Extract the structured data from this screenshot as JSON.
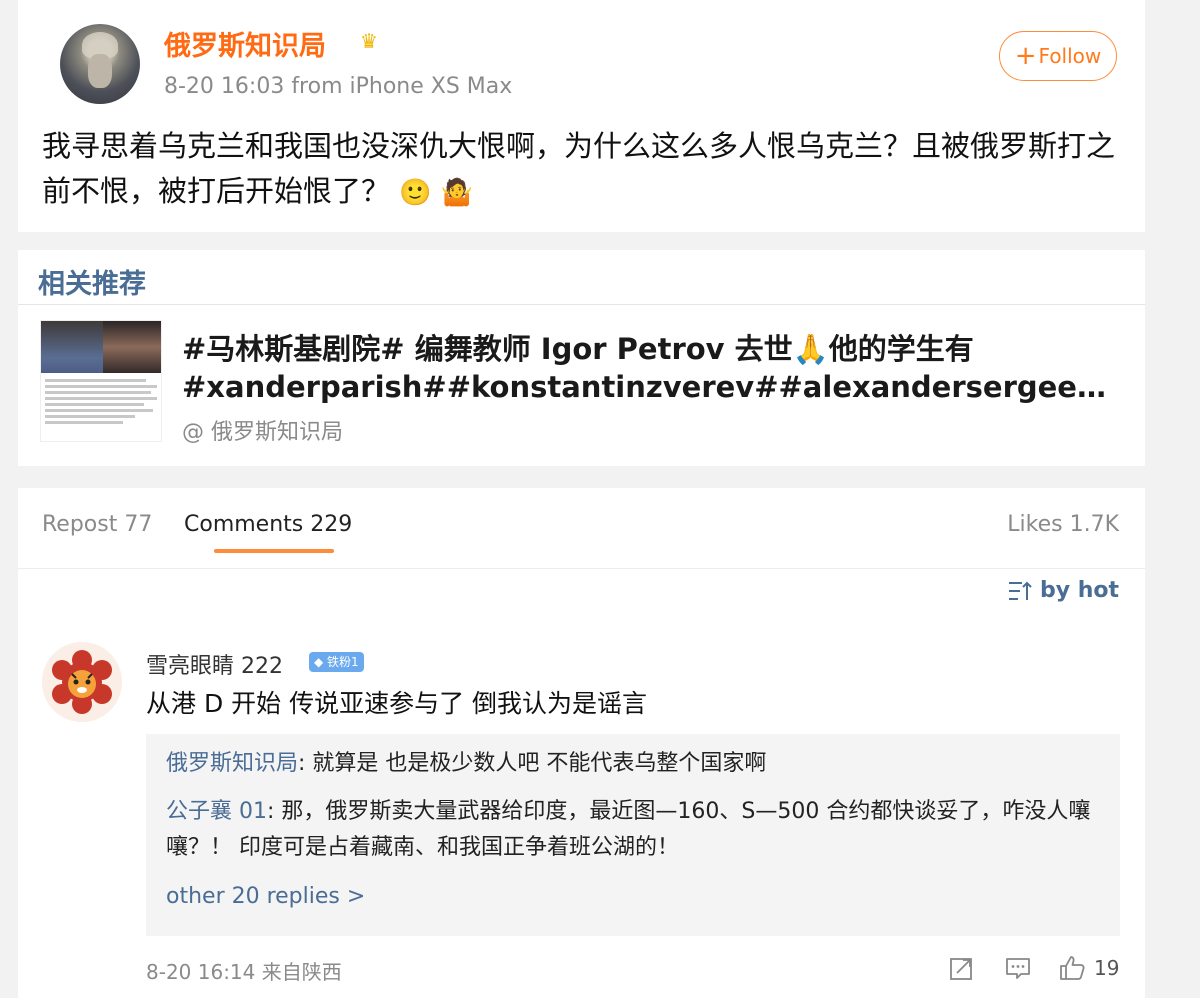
{
  "post": {
    "author": "俄罗斯知识局",
    "meta": "8-20 16:03  from iPhone XS Max",
    "follow_label": "Follow",
    "text": "我寻思着乌克兰和我国也没深仇大恨啊，为什么这么多人恨乌克兰？且被俄罗斯打之前不恨，被打后开始恨了？",
    "emojis": [
      "🙂",
      "🤷"
    ]
  },
  "related": {
    "title": "相关推荐",
    "line1": "#马林斯基剧院# 编舞教师 Igor Petrov 去世🙏他的学生有",
    "line2": "#xanderparish##konstantinzverev##alexandersergeev##ar...",
    "source": "@ 俄罗斯知识局"
  },
  "tabs": {
    "repost": "Repost 77",
    "comments": "Comments 229",
    "likes": "Likes 1.7K"
  },
  "sort_label": "by hot",
  "comment": {
    "user": "雪亮眼睛 222",
    "badge": "铁粉1",
    "text": "从港 D 开始 传说亚速参与了 倒我认为是谣言",
    "replies": [
      {
        "author": "俄罗斯知识局",
        "text": ": 就算是 也是极少数人吧 不能代表乌整个国家啊"
      },
      {
        "author": "公子襄 01",
        "text": ": 那，俄罗斯卖大量武器给印度，最近图—160、S—500 合约都快谈妥了，咋没人嚷嚷？！ 印度可是占着藏南、和我国正争着班公湖的！"
      }
    ],
    "more_replies": "other 20 replies >",
    "meta": "8-20 16:14  来自陕西",
    "likes": "19"
  },
  "colors": {
    "accent_orange": "#ff7a1a",
    "link_blue": "#4a6d96",
    "background": "#f2f2f2"
  }
}
